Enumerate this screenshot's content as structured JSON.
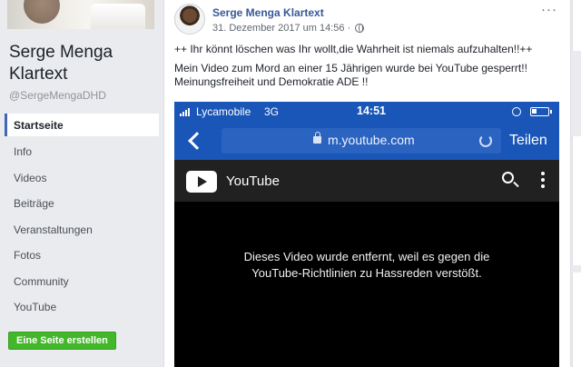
{
  "page": {
    "name": "Serge Menga Klartext",
    "handle": "@SergeMengaDHD",
    "nav": [
      "Startseite",
      "Info",
      "Videos",
      "Beiträge",
      "Veranstaltungen",
      "Fotos",
      "Community",
      "YouTube"
    ],
    "active_nav": "Startseite",
    "create_page_label": "Eine Seite erstellen"
  },
  "post": {
    "author": "Serge Menga Klartext",
    "timestamp": "31. Dezember 2017 um 14:56 ·",
    "more_label": "···",
    "lines": [
      "++ Ihr könnt löschen was Ihr wollt,die Wahrheit ist niemals aufzuhalten!!++",
      "Mein Video zum Mord an einer 15 Jährigen wurde bei YouTube gesperrt!! Meinungsfreiheit und Demokratie ADE !!"
    ]
  },
  "embed": {
    "status": {
      "carrier": "Lycamobile",
      "network": "3G",
      "time": "14:51"
    },
    "browser": {
      "url": "m.youtube.com",
      "share_label": "Teilen"
    },
    "youtube": {
      "brand": "YouTube",
      "message": "Dieses Video wurde entfernt, weil es gegen die YouTube-Richtlinien zu Hassreden verstößt."
    }
  },
  "colors": {
    "fb_link": "#385898",
    "fb_green": "#42b72a",
    "ios_blue": "#1a56b8",
    "yt_dark": "#212121"
  },
  "icons": [
    "globe-icon",
    "more-icon",
    "signal-icon",
    "battery-icon",
    "back-icon",
    "padlock-icon",
    "reload-icon",
    "youtube-logo-icon",
    "search-icon",
    "kebab-icon"
  ]
}
